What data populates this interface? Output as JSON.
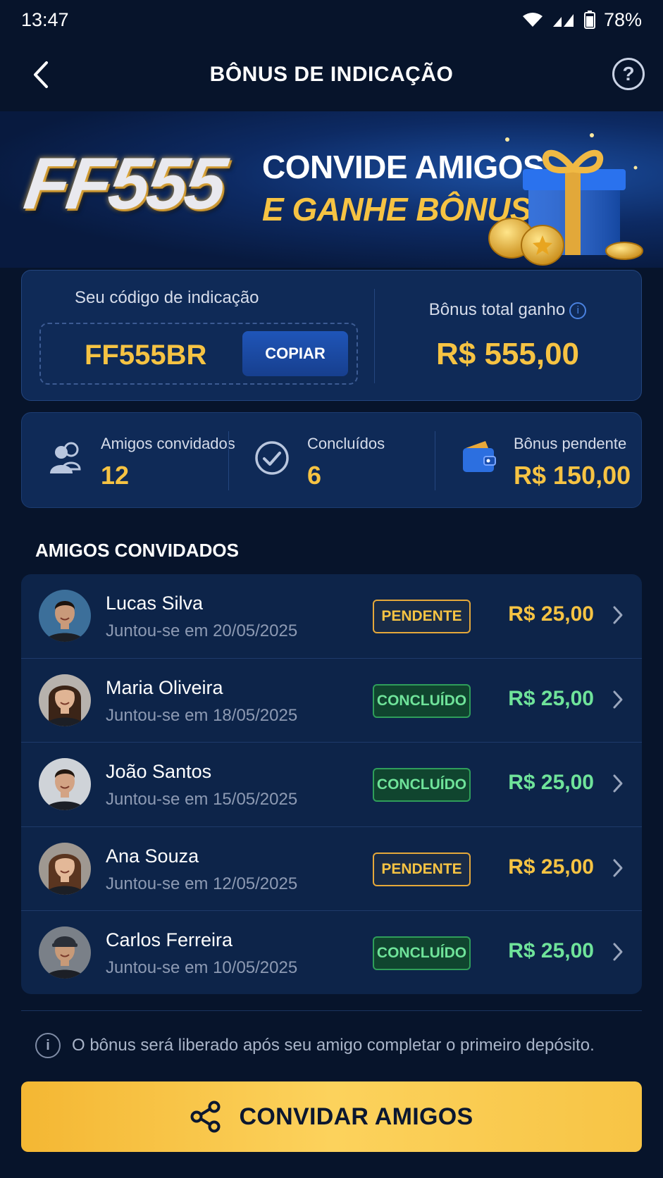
{
  "status_bar": {
    "time": "13:47",
    "battery": "78%",
    "icons": [
      "wifi-icon",
      "signal-icon",
      "battery-icon"
    ]
  },
  "header": {
    "title": "BÔNUS DE INDICAÇÃO",
    "back_icon": "chevron-left-icon",
    "help_icon": "question-circle-icon",
    "help_glyph": "?"
  },
  "banner": {
    "logo": "FF555",
    "line1": "CONVIDE AMIGOS",
    "line2": "E GANHE BÔNUS!"
  },
  "referral": {
    "code_label": "Seu código de indicação",
    "code": "FF555BR",
    "copy_label": "COPIAR",
    "total_label": "Bônus total ganho",
    "total_value": "R$ 555,00"
  },
  "stats": [
    {
      "icon": "users-icon",
      "label": "Amigos convidados",
      "value": "12"
    },
    {
      "icon": "check-circle-icon",
      "label": "Concluídos",
      "value": "6"
    },
    {
      "icon": "wallet-icon",
      "label": "Bônus pendente",
      "value": "R$ 150,00"
    }
  ],
  "friends_section_title": "AMIGOS CONVIDADOS",
  "friends": [
    {
      "name": "Lucas Silva",
      "joined": "Juntou-se em 20/05/2025",
      "status": "PENDENTE",
      "status_type": "pending",
      "amount": "R$ 25,00",
      "avatar_skin": "#c99a7a",
      "avatar_hair": "#1c130e",
      "avatar_bg": "#3c6f9a",
      "avatar_long_hair": false,
      "avatar_cap": false
    },
    {
      "name": "Maria Oliveira",
      "joined": "Juntou-se em 18/05/2025",
      "status": "CONCLUÍDO",
      "status_type": "done",
      "amount": "R$ 25,00",
      "avatar_skin": "#e0b494",
      "avatar_hair": "#3b2417",
      "avatar_bg": "#b7b2ad",
      "avatar_long_hair": true,
      "avatar_cap": false
    },
    {
      "name": "João Santos",
      "joined": "Juntou-se em 15/05/2025",
      "status": "CONCLUÍDO",
      "status_type": "done",
      "amount": "R$ 25,00",
      "avatar_skin": "#d3a384",
      "avatar_hair": "#231811",
      "avatar_bg": "#cfd3d8",
      "avatar_long_hair": false,
      "avatar_cap": false
    },
    {
      "name": "Ana Souza",
      "joined": "Juntou-se em 12/05/2025",
      "status": "PENDENTE",
      "status_type": "pending",
      "amount": "R$ 25,00",
      "avatar_skin": "#e3b898",
      "avatar_hair": "#5a3520",
      "avatar_bg": "#9f9891",
      "avatar_long_hair": true,
      "avatar_cap": false
    },
    {
      "name": "Carlos Ferreira",
      "joined": "Juntou-se em 10/05/2025",
      "status": "CONCLUÍDO",
      "status_type": "done",
      "amount": "R$ 25,00",
      "avatar_skin": "#c89a78",
      "avatar_hair": "#1a1a1a",
      "avatar_bg": "#7a8088",
      "avatar_long_hair": false,
      "avatar_cap": true
    }
  ],
  "note": "O bônus será liberado após seu amigo completar o primeiro depósito.",
  "note_glyph": "i",
  "cta_label": "CONVIDAR AMIGOS",
  "colors": {
    "background": "#07142b",
    "card": "#0f2a57",
    "gold": "#f6c343",
    "green": "#6fe39a",
    "blue_button": "#1f55b8"
  }
}
